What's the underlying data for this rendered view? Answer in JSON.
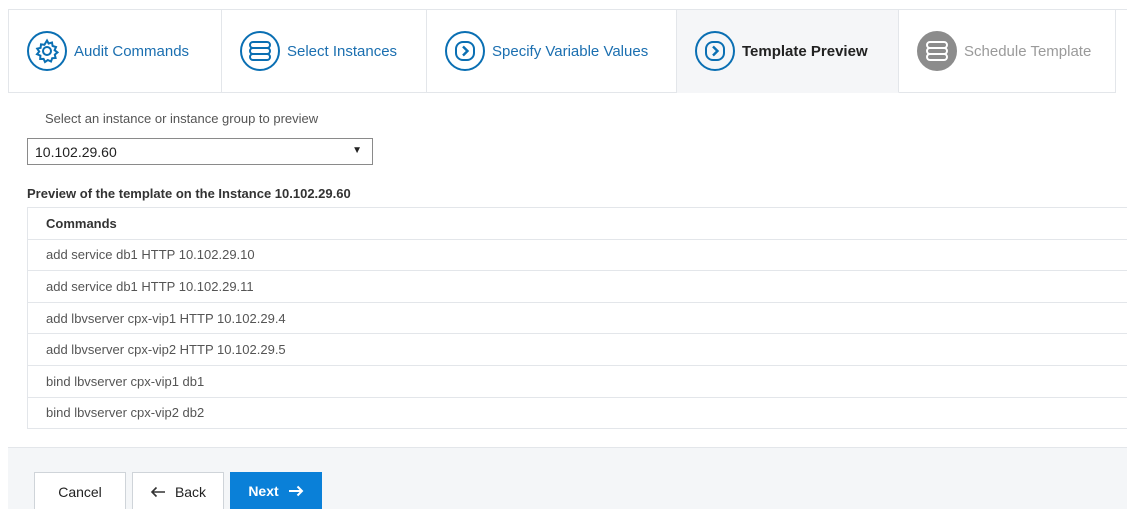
{
  "wizard": {
    "steps": [
      {
        "label": "Audit Commands",
        "icon": "gear-icon",
        "state": "complete"
      },
      {
        "label": "Select Instances",
        "icon": "server-stack-icon",
        "state": "complete"
      },
      {
        "label": "Specify Variable Values",
        "icon": "chevron-right-icon",
        "state": "complete"
      },
      {
        "label": "Template Preview",
        "icon": "chevron-right-icon",
        "state": "active"
      },
      {
        "label": "Schedule Template",
        "icon": "server-stack-icon",
        "state": "disabled"
      }
    ]
  },
  "instance_select": {
    "caption": "Select an instance or instance group to preview",
    "value": "10.102.29.60"
  },
  "preview": {
    "title": "Preview of the template on the Instance 10.102.29.60",
    "header": "Commands",
    "commands": [
      "add service db1 HTTP 10.102.29.10",
      "add service db1 HTTP 10.102.29.11",
      "add lbvserver cpx-vip1 HTTP 10.102.29.4",
      "add lbvserver cpx-vip2 HTTP 10.102.29.5",
      "bind lbvserver cpx-vip1 db1",
      "bind lbvserver cpx-vip2 db2"
    ]
  },
  "footer": {
    "cancel_label": "Cancel",
    "back_label": "Back",
    "next_label": "Next"
  },
  "colors": {
    "accent": "#0a80d8",
    "step_blue": "#1b6fb0",
    "disabled": "#8c8c8c"
  }
}
